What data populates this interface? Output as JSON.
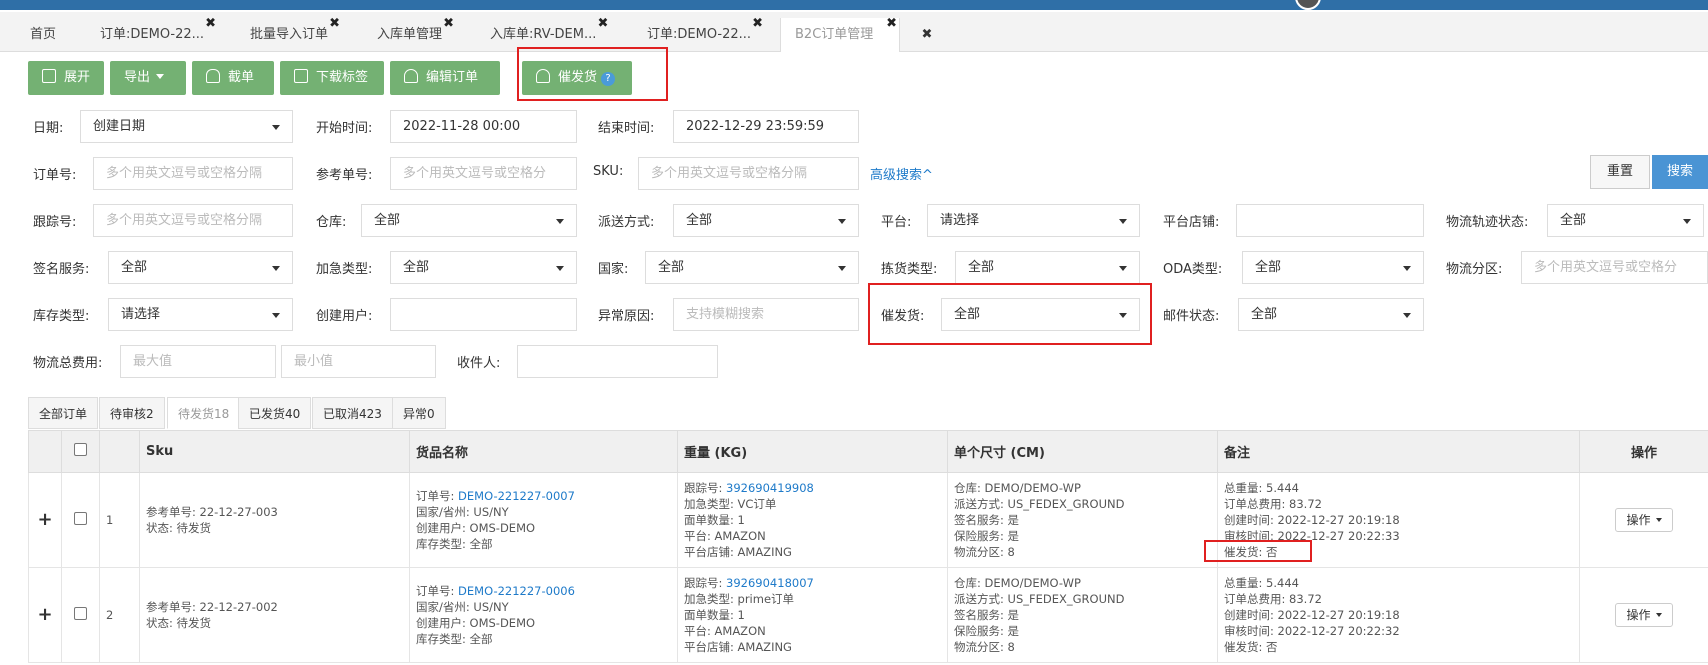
{
  "tabs": [
    {
      "label": "首页"
    },
    {
      "label": "订单:DEMO-22..."
    },
    {
      "label": "批量导入订单"
    },
    {
      "label": "入库单管理"
    },
    {
      "label": "入库单:RV-DEM..."
    },
    {
      "label": "订单:DEMO-22..."
    },
    {
      "label": "B2C订单管理"
    }
  ],
  "toolbar": {
    "expand": "展开",
    "export": "导出",
    "intercept": "截单",
    "download_label": "下载标签",
    "edit_order": "编辑订单",
    "urge": "催发货",
    "help": "?"
  },
  "filters": {
    "date_label": "日期:",
    "date_value": "创建日期",
    "start_label": "开始时间:",
    "start_value": "2022-11-28 00:00",
    "end_label": "结束时间:",
    "end_value": "2022-12-29 23:59:59",
    "order_no_label": "订单号:",
    "order_no_ph": "多个用英文逗号或空格分隔",
    "ref_no_label": "参考单号:",
    "ref_no_ph": "多个用英文逗号或空格分",
    "sku_label": "SKU:",
    "sku_ph": "多个用英文逗号或空格分隔",
    "advanced": "高级搜索^",
    "tracking_label": "跟踪号:",
    "tracking_ph": "多个用英文逗号或空格分隔",
    "warehouse_label": "仓库:",
    "warehouse_value": "全部",
    "delivery_label": "派送方式:",
    "delivery_value": "全部",
    "platform_label": "平台:",
    "platform_value": "请选择",
    "shop_label": "平台店铺:",
    "track_status_label": "物流轨迹状态:",
    "track_status_value": "全部",
    "sign_label": "签名服务:",
    "sign_value": "全部",
    "urgent_label": "加急类型:",
    "urgent_value": "全部",
    "country_label": "国家:",
    "country_value": "全部",
    "pick_label": "拣货类型:",
    "pick_value": "全部",
    "oda_label": "ODA类型:",
    "oda_value": "全部",
    "zone_label": "物流分区:",
    "zone_ph": "多个用英文逗号或空格分",
    "stock_label": "库存类型:",
    "stock_value": "请选择",
    "creator_label": "创建用户:",
    "exception_label": "异常原因:",
    "exception_ph": "支持模糊搜索",
    "urge_label": "催发货:",
    "urge_value": "全部",
    "mail_label": "邮件状态:",
    "mail_value": "全部",
    "fee_label": "物流总费用:",
    "fee_max_ph": "最大值",
    "fee_min_ph": "最小值",
    "receiver_label": "收件人:",
    "reset": "重置",
    "search": "搜索"
  },
  "status_tabs": [
    "全部订单",
    "待审核2",
    "待发货18",
    "已发货40",
    "已取消423",
    "异常0"
  ],
  "table": {
    "headers": [
      "Sku",
      "货品名称",
      "重量 (KG)",
      "单个尺寸 (CM)",
      "备注",
      "操作"
    ],
    "rows": [
      {
        "index": "1",
        "ref": "参考单号: 22-12-27-003",
        "status": "状态: 待发货",
        "order_label": "订单号:",
        "order_no": "DEMO-221227-0007",
        "region": "国家/省州: US/NY",
        "creator": "创建用户: OMS-DEMO",
        "stock": "库存类型: 全部",
        "track_label": "跟踪号:",
        "track_no": "392690419908",
        "urgent": "加急类型: VC订单",
        "qty": "面单数量: 1",
        "platform": "平台: AMAZON",
        "shop": "平台店铺: AMAZING",
        "warehouse": "仓库: DEMO/DEMO-WP",
        "delivery": "派送方式: US_FEDEX_GROUND",
        "sign": "签名服务: 是",
        "insurance": "保险服务: 是",
        "zone": "物流分区: 8",
        "weight": "总重量: 5.444",
        "fee": "订单总费用: 83.72",
        "created": "创建时间: 2022-12-27 20:19:18",
        "audited": "审核时间: 2022-12-27 20:22:33",
        "urged": "催发货: 否",
        "op": "操作"
      },
      {
        "index": "2",
        "ref": "参考单号: 22-12-27-002",
        "status": "状态: 待发货",
        "order_label": "订单号:",
        "order_no": "DEMO-221227-0006",
        "region": "国家/省州: US/NY",
        "creator": "创建用户: OMS-DEMO",
        "stock": "库存类型: 全部",
        "track_label": "跟踪号:",
        "track_no": "392690418007",
        "urgent": "加急类型: prime订单",
        "qty": "面单数量: 1",
        "platform": "平台: AMAZON",
        "shop": "平台店铺: AMAZING",
        "warehouse": "仓库: DEMO/DEMO-WP",
        "delivery": "派送方式: US_FEDEX_GROUND",
        "sign": "签名服务: 是",
        "insurance": "保险服务: 是",
        "zone": "物流分区: 8",
        "weight": "总重量: 5.444",
        "fee": "订单总费用: 83.72",
        "created": "创建时间: 2022-12-27 20:19:18",
        "audited": "审核时间: 2022-12-27 20:22:32",
        "urged": "催发货: 否",
        "op": "操作"
      }
    ]
  }
}
